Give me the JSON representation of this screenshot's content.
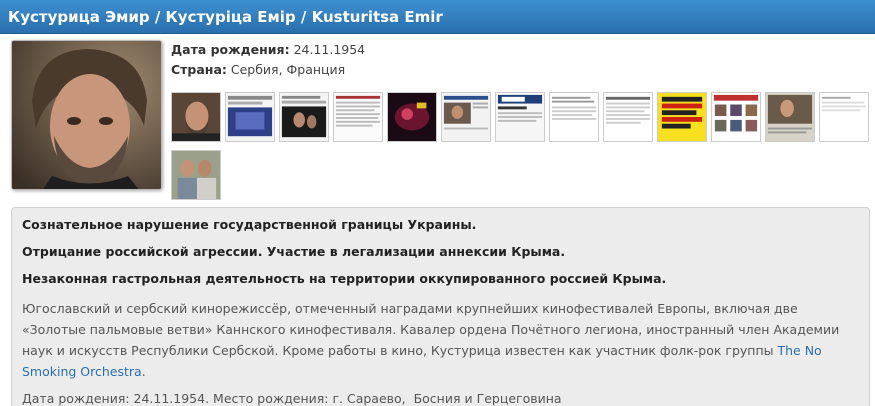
{
  "header": {
    "title": "Кустурица Эмир / Кустуріца Емір / Kusturitsa Emir"
  },
  "info": {
    "birth_label": "Дата рождения:",
    "birth_value": "24.11.1954",
    "country_label": "Страна:",
    "country_value": "Сербия, Франция"
  },
  "gallery": {
    "thumbs_row1": 12,
    "thumbs_row2": 1
  },
  "content": {
    "warnings": [
      "Сознательное нарушение государственной границы Украины.",
      "Отрицание российской агрессии. Участие в легализации аннексии Крыма.",
      "Незаконная гастрольная деятельность на территории оккупированного россией Крыма."
    ],
    "description_text": "Югославский и сербский кинорежиссёр, отмеченный наградами крупнейших кинофестивалей Европы, включая две «Золотые пальмовые ветви» Каннского кинофестиваля. Кавалер ордена Почётного легиона, иностранный член Академии наук и искусств Республики Сербской. Кроме работы в кино, Кустурица известен как участник фолк-рок группы ",
    "band_link": "The No Smoking Orchestra",
    "description_end": ".",
    "birth_line": "Дата рождения: 24.11.1954. Место рождения: г. Сараево,  Босния и Герцеговина"
  }
}
